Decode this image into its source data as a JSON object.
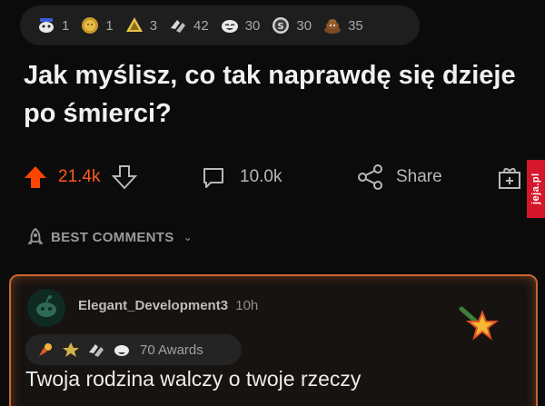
{
  "post": {
    "awards": [
      {
        "icon": "snoo-face-icon",
        "count": "1"
      },
      {
        "icon": "gold-sun-icon",
        "count": "1"
      },
      {
        "icon": "helpful-badge-icon",
        "count": "3"
      },
      {
        "icon": "hands-clap-icon",
        "count": "42"
      },
      {
        "icon": "laughing-face-icon",
        "count": "30"
      },
      {
        "icon": "silver-coin-icon",
        "count": "30"
      },
      {
        "icon": "poop-face-icon",
        "count": "35"
      }
    ],
    "title": "Jak myślisz, co tak naprawdę się dzieje po śmierci?",
    "upvotes": "21.4k",
    "comments": "10.0k",
    "share_label": "Share",
    "accent": "#ff5a1f"
  },
  "watermark": "jeja.pl",
  "best_comments_label": "BEST COMMENTS",
  "comment": {
    "username": "Elegant_Development3",
    "time": "10h",
    "awards_label": "70 Awards",
    "text": "Twoja rodzina walczy o twoje rzeczy",
    "border_color": "#c9652e"
  }
}
